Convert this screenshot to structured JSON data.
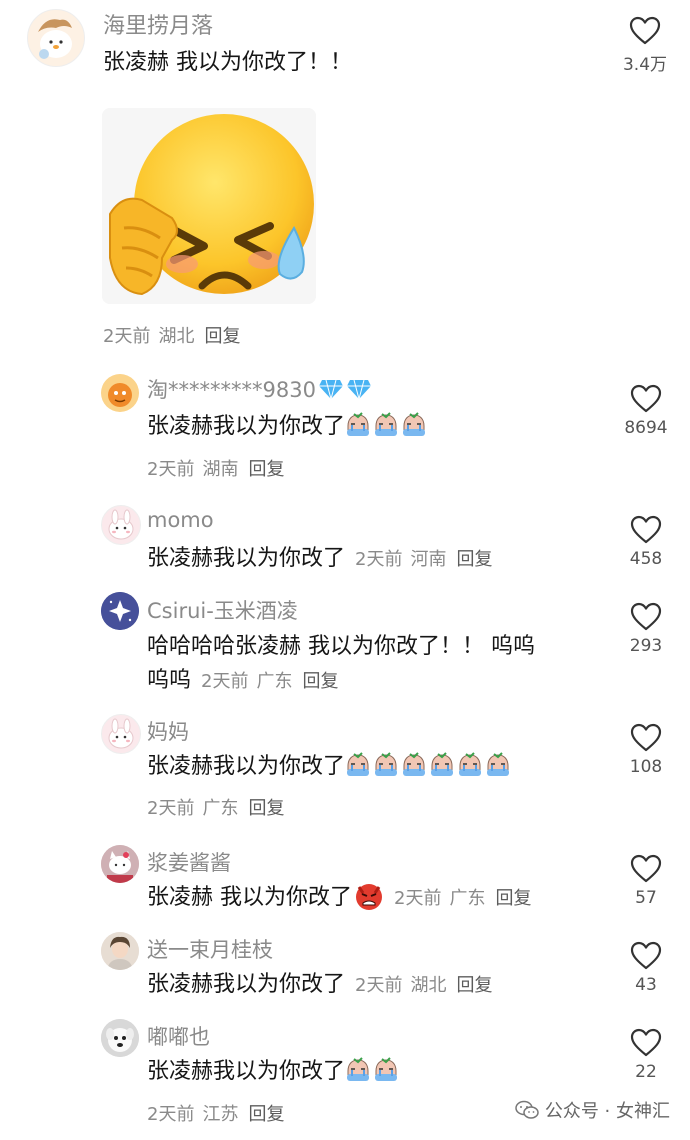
{
  "colors": {
    "meta": "#8a8a8a",
    "text": "#161616",
    "background": "#ffffff"
  },
  "comments": [
    {
      "username": "海里捞月落",
      "text": "张凌赫 我以为你改了！！",
      "time": "2天前",
      "region": "湖北",
      "reply": "回复",
      "likes": "3.4万",
      "sticker": "sweating-squint-face"
    },
    {
      "username": "淘*********9830",
      "text": "张凌赫我以为你改了",
      "time": "2天前",
      "region": "湖南",
      "reply": "回复",
      "likes": "8694",
      "emoji_count": 3
    },
    {
      "username": "momo",
      "text": "张凌赫我以为你改了",
      "time": "2天前",
      "region": "河南",
      "reply": "回复",
      "likes": "458"
    },
    {
      "username": "Csirui-玉米酒凌",
      "text_line1": "哈哈哈哈张凌赫 我以为你改了！！ 呜呜",
      "text_line2": "呜呜",
      "time": "2天前",
      "region": "广东",
      "reply": "回复",
      "likes": "293"
    },
    {
      "username": "妈妈",
      "text": "张凌赫我以为你改了",
      "time": "2天前",
      "region": "广东",
      "reply": "回复",
      "likes": "108",
      "emoji_count": 6
    },
    {
      "username": "浆姜酱酱",
      "text": "张凌赫 我以为你改了",
      "time": "2天前",
      "region": "广东",
      "reply": "回复",
      "likes": "57"
    },
    {
      "username": "送一束月桂枝",
      "text": "张凌赫我以为你改了",
      "time": "2天前",
      "region": "湖北",
      "reply": "回复",
      "likes": "43"
    },
    {
      "username": "嘟嘟也",
      "text": "张凌赫我以为你改了",
      "time": "2天前",
      "region": "江苏",
      "reply": "回复",
      "likes": "22",
      "emoji_count": 2
    }
  ],
  "watermark": {
    "label": "公众号 · 女神汇",
    "icon": "wechat-icon"
  }
}
